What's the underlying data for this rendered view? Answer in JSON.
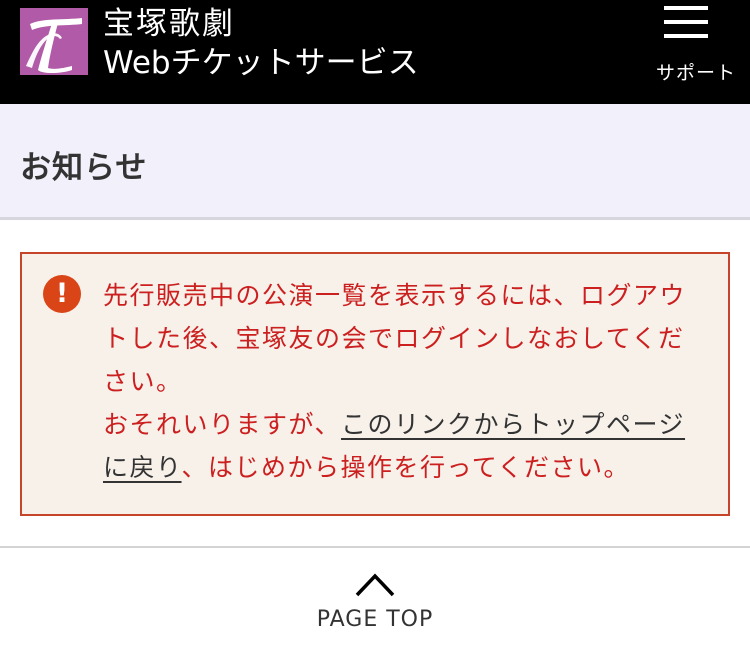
{
  "header": {
    "logo_letter": "T",
    "brand_name": "宝塚歌劇",
    "service_name": "Webチケットサービス",
    "menu_label": "サポート"
  },
  "page": {
    "title": "お知らせ"
  },
  "notice": {
    "icon": "exclamation-icon",
    "message": "先行販売中の公演一覧を表示するには、ログアウトした後、宝塚友の会でログインしなおしてください。",
    "line2_prefix": "おそれいりますが、",
    "link_text": "このリンクからトップページに戻り",
    "line2_suffix": "、はじめから操作を行ってください。"
  },
  "footer": {
    "page_top_label": "PAGE TOP"
  },
  "colors": {
    "header_bg": "#000000",
    "logo_bg": "#b05aa8",
    "title_bar_bg": "#f2f1fb",
    "notice_bg": "#f7f1ea",
    "notice_border": "#c6442a",
    "notice_text": "#cc1f1f",
    "alert_icon": "#d94517"
  }
}
